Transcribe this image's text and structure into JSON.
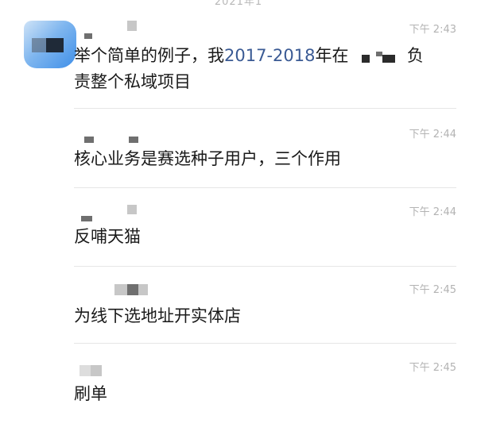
{
  "header": {
    "date_text": "2021年1"
  },
  "messages": [
    {
      "time": "下午 2:43",
      "text_before": "举个简单的例子，我",
      "year_range": "2017-2018",
      "text_mid": "年在",
      "text_after": "负",
      "text_line2": "责整个私域项目"
    },
    {
      "time": "下午 2:44",
      "text": "核心业务是赛选种子用户，三个作用"
    },
    {
      "time": "下午 2:44",
      "text": "反哺天猫"
    },
    {
      "time": "下午 2:45",
      "text": "为线下选地址开实体店"
    },
    {
      "time": "下午 2:45",
      "text": "刷单"
    }
  ],
  "colors": {
    "link": "#3a5a94",
    "timestamp": "#b3b3b3",
    "divider": "#e6e6e6",
    "avatar": "#3f8fe8"
  },
  "icons": {
    "avatar": "blurred-avatar-icon"
  }
}
